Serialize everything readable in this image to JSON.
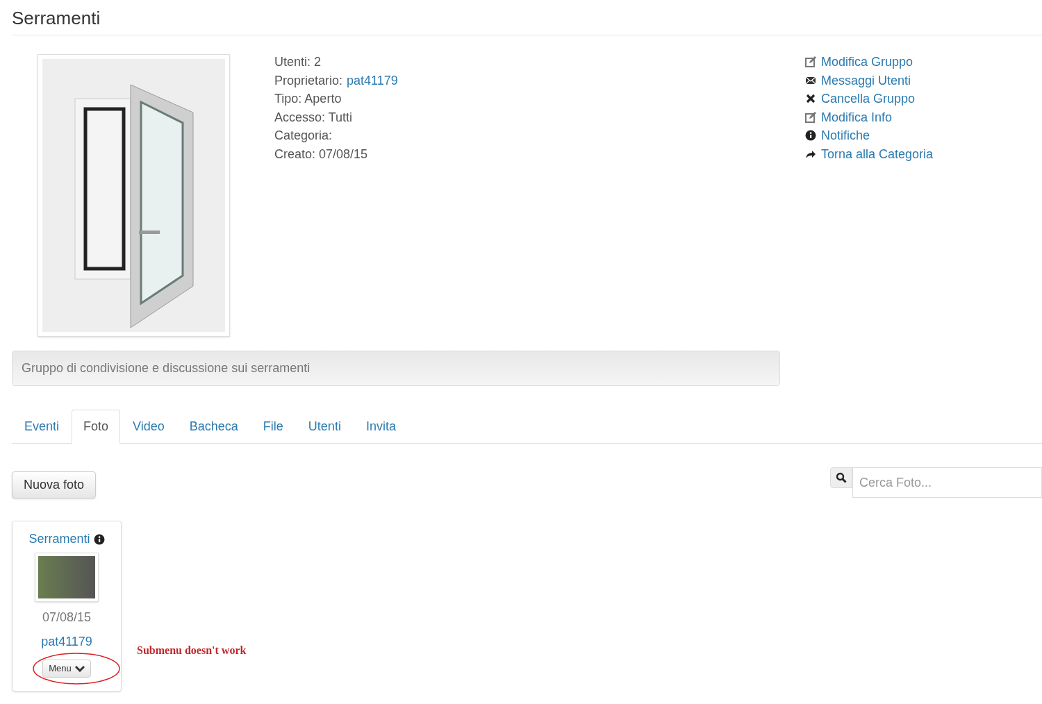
{
  "title": "Serramenti",
  "info": [
    {
      "label": "Utenti: 2"
    },
    {
      "label": "Proprietario:",
      "link": "pat41179"
    },
    {
      "label": "Tipo: Aperto"
    },
    {
      "label": "Accesso: Tutti"
    },
    {
      "label": "Categoria:"
    },
    {
      "label": "Creato: 07/08/15"
    }
  ],
  "actions": [
    {
      "kind": "edit",
      "label": "Modifica Gruppo"
    },
    {
      "kind": "mail",
      "label": "Messaggi Utenti"
    },
    {
      "kind": "delete",
      "label": "Cancella Gruppo"
    },
    {
      "kind": "edit",
      "label": "Modifica Info"
    },
    {
      "kind": "info",
      "label": "Notifiche"
    },
    {
      "kind": "share",
      "label": "Torna alla Categoria"
    }
  ],
  "description": "Gruppo di condivisione e discussione sui serramenti",
  "tabs": [
    {
      "label": "Eventi",
      "selected": false
    },
    {
      "label": "Foto",
      "selected": true
    },
    {
      "label": "Video",
      "selected": false
    },
    {
      "label": "Bacheca",
      "selected": false
    },
    {
      "label": "File",
      "selected": false
    },
    {
      "label": "Utenti",
      "selected": false
    },
    {
      "label": "Invita",
      "selected": false
    }
  ],
  "new_button": "Nuova foto",
  "search": {
    "placeholder": "Cerca Foto..."
  },
  "photos": [
    {
      "title": "Serramenti",
      "date": "07/08/15",
      "owner": "pat41179",
      "menu": "Menu"
    }
  ],
  "annotation": "Submenu doesn't work"
}
